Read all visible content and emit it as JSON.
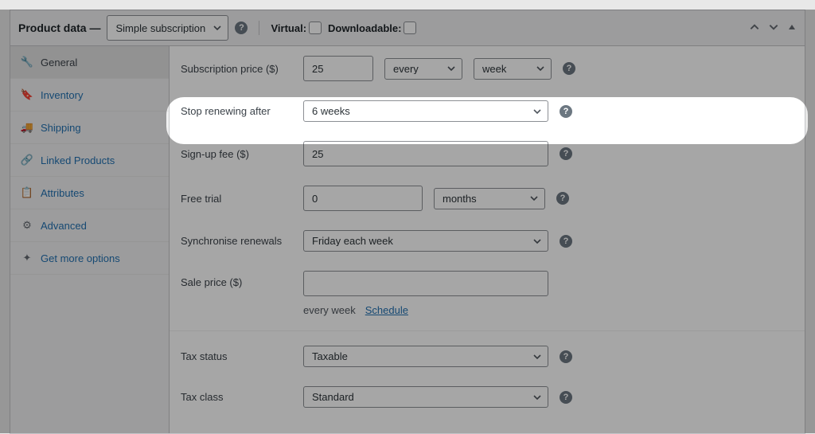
{
  "header": {
    "title": "Product data —",
    "type_selected": "Simple subscription",
    "virtual_label": "Virtual:",
    "downloadable_label": "Downloadable:"
  },
  "tabs": [
    {
      "icon": "wrench",
      "label": "General",
      "active": true
    },
    {
      "icon": "tag",
      "label": "Inventory",
      "active": false
    },
    {
      "icon": "truck",
      "label": "Shipping",
      "active": false
    },
    {
      "icon": "link",
      "label": "Linked Products",
      "active": false
    },
    {
      "icon": "list",
      "label": "Attributes",
      "active": false
    },
    {
      "icon": "gear",
      "label": "Advanced",
      "active": false
    },
    {
      "icon": "spark",
      "label": "Get more options",
      "active": false
    }
  ],
  "fields": {
    "subscription_price": {
      "label": "Subscription price ($)",
      "value": "25",
      "interval": "every",
      "period": "week"
    },
    "stop_renewing": {
      "label": "Stop renewing after",
      "value": "6 weeks"
    },
    "signup_fee": {
      "label": "Sign-up fee ($)",
      "value": "25"
    },
    "free_trial": {
      "label": "Free trial",
      "value": "0",
      "unit": "months"
    },
    "sync_renewals": {
      "label": "Synchronise renewals",
      "value": "Friday each week"
    },
    "sale_price": {
      "label": "Sale price ($)",
      "value": "",
      "subtext": "every week",
      "schedule_link": "Schedule"
    },
    "tax_status": {
      "label": "Tax status",
      "value": "Taxable"
    },
    "tax_class": {
      "label": "Tax class",
      "value": "Standard"
    }
  }
}
